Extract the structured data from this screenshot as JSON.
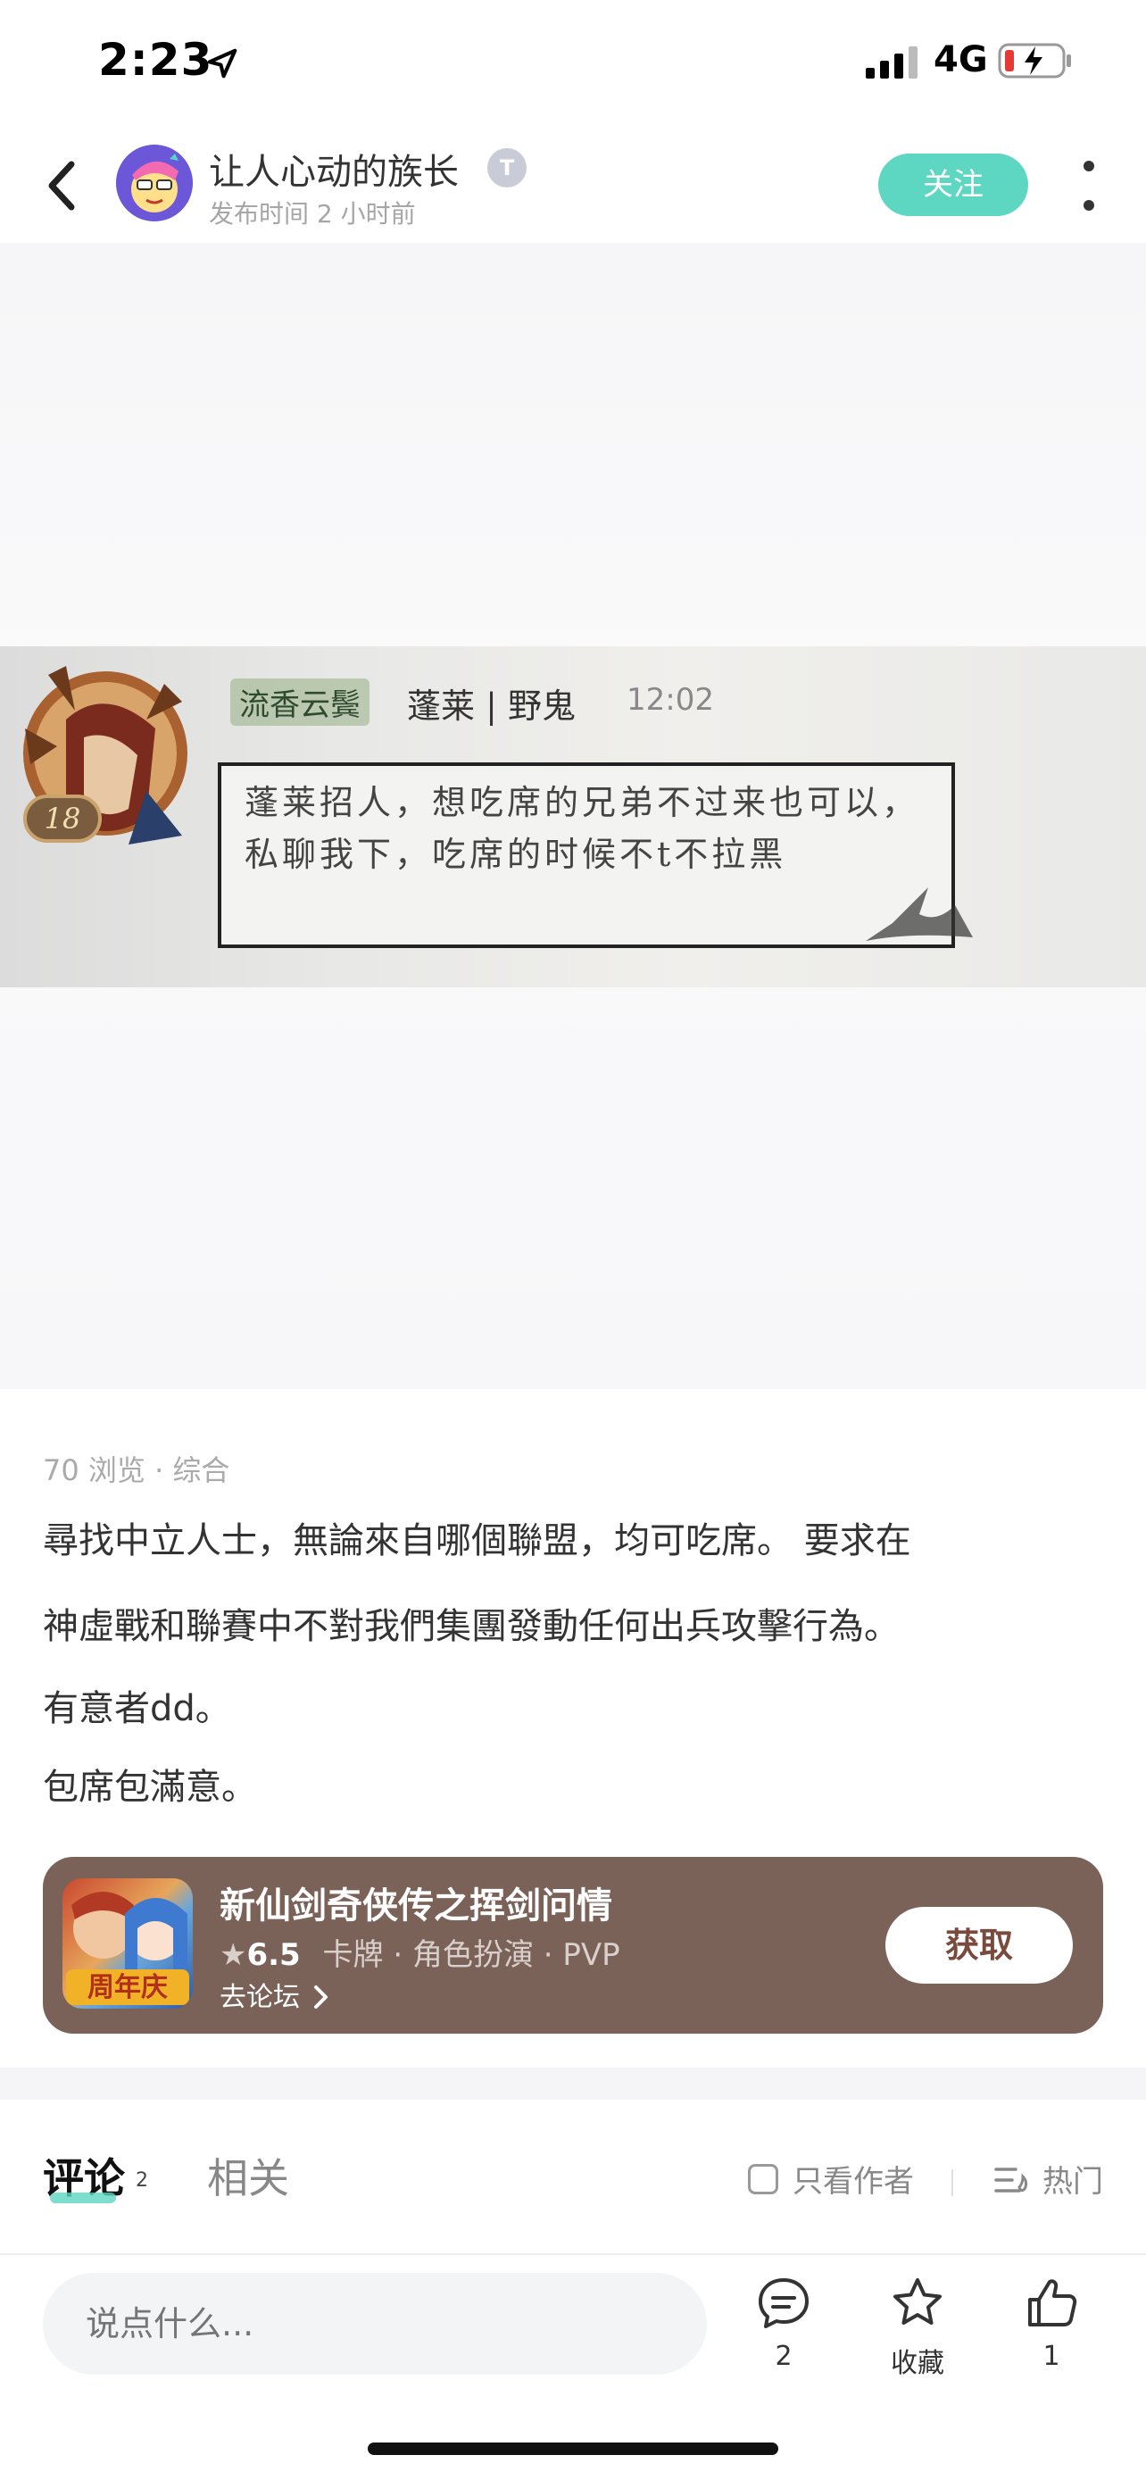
{
  "status_bar": {
    "time": "2:23",
    "network": "4G"
  },
  "header": {
    "author_name": "让人心动的族长",
    "level_badge": "T",
    "post_time": "发布时间 2 小时前",
    "follow_label": "关注"
  },
  "image": {
    "chat_nick_tag": "流香云鬓",
    "chat_name": "蓬莱 | 野鬼",
    "chat_time": "12:02",
    "chat_level": "18",
    "chat_message": "蓬莱招人，想吃席的兄弟不过来也可以，私聊我下，吃席的时候不t不拉黑"
  },
  "post": {
    "meta": "70 浏览 · 综合",
    "paragraphs": [
      "尋找中立人士，無論來自哪個聯盟，均可吃席。 要求在",
      "神虛戰和聯賽中不對我們集團發動任何出兵攻擊行為。",
      "有意者dd。",
      "包席包滿意。"
    ]
  },
  "game_card": {
    "title": "新仙剑奇侠传之挥剑问情",
    "score": "6.5",
    "tags": "卡牌 · 角色扮演 · PVP",
    "forum_link": "去论坛",
    "get_label": "获取",
    "icon_badge": "周年庆"
  },
  "tabs": {
    "comment_label": "评论",
    "comment_count": "2",
    "related_label": "相关",
    "author_only_label": "只看作者",
    "sort_label": "热门"
  },
  "bottom_bar": {
    "input_placeholder": "说点什么...",
    "comment_count": "2",
    "favorite_label": "收藏",
    "like_count": "1"
  }
}
